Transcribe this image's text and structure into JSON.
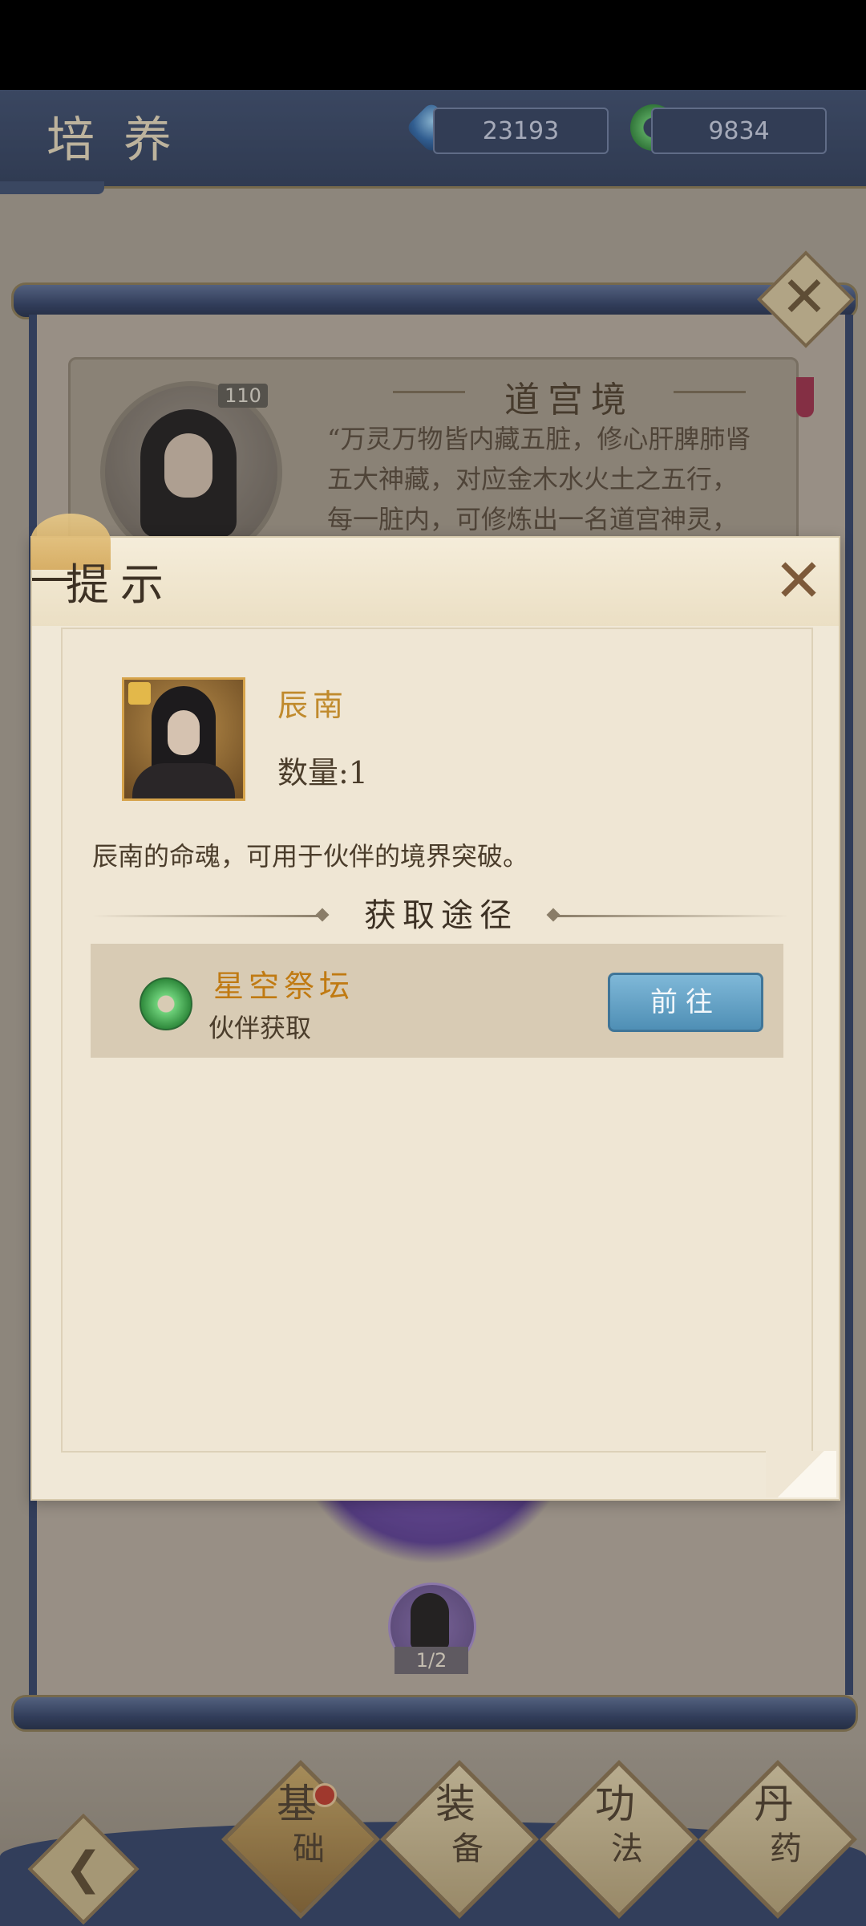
{
  "header": {
    "title": "培养",
    "resources": [
      {
        "icon": "crystal-gem-icon",
        "value": "23193"
      },
      {
        "icon": "jade-coin-icon",
        "value": "9834"
      }
    ]
  },
  "background_panel": {
    "level": "110",
    "realm_title": "道宫境",
    "realm_desc": "“万灵万物皆内藏五脏，修心肝脾肺肾五大神藏，对应金木水火土之五行，每一脏内，可修炼出一名道宫神灵，五神皆出後我家圆满，。”",
    "partner_progress": "1/2"
  },
  "modal": {
    "title": "提示",
    "item": {
      "name": "辰南",
      "quantity": "数量:1",
      "description": "辰南的命魂，可用于伙伴的境界突破。"
    },
    "route_section_title": "获取途径",
    "routes": [
      {
        "name": "星空祭坛",
        "subtitle": "伙伴获取",
        "button": "前往"
      }
    ]
  },
  "bottom_nav": {
    "items": [
      {
        "label_top": "基",
        "label_bottom": "础",
        "active": true
      },
      {
        "label_top": "装",
        "label_bottom": "备",
        "active": false
      },
      {
        "label_top": "功",
        "label_bottom": "法",
        "active": false
      },
      {
        "label_top": "丹",
        "label_bottom": "药",
        "active": false
      }
    ]
  },
  "colors": {
    "header_bg": "#2c3c5c",
    "parchment": "#f0e8d7",
    "gold_text": "#c08a2c",
    "button_blue": "#4f8fb5"
  }
}
